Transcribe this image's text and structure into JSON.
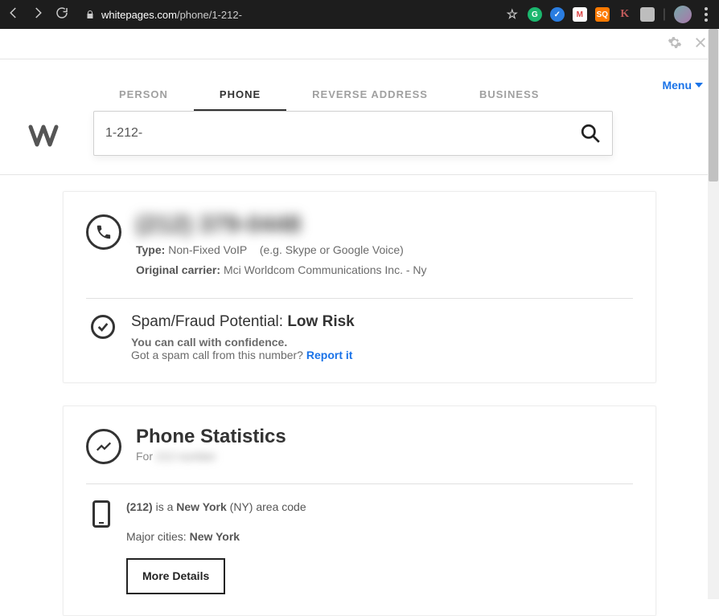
{
  "browser": {
    "url_host": "whitepages.com",
    "url_path": "/phone/1-212-",
    "extensions": {
      "star": "☆",
      "grammarly_bg": "#1bb76e",
      "blue_check_bg": "#2a7de1",
      "mail_letter": "M",
      "sq_text": "SQ",
      "sq_bg": "#ff7a00",
      "k_letter": "K",
      "k_color": "#c05a5a",
      "gray_bg": "#bdbdbd"
    }
  },
  "tabs": {
    "person": "PERSON",
    "phone": "PHONE",
    "reverse": "REVERSE ADDRESS",
    "business": "BUSINESS"
  },
  "menu_label": "Menu",
  "search": {
    "value": "1-212-"
  },
  "phone_result": {
    "number_blurred": "(212) 379-0448",
    "type_label": "Type:",
    "type_value": "Non-Fixed VoIP",
    "type_hint": "(e.g. Skype or Google Voice)",
    "carrier_label": "Original carrier:",
    "carrier_value": "Mci Worldcom Communications Inc. - Ny",
    "spam": {
      "prefix": "Spam/Fraud Potential:",
      "level": "Low Risk",
      "confidence": "You can call with confidence.",
      "got_spam": "Got a spam call from this number?",
      "report": "Report it"
    }
  },
  "stats": {
    "title": "Phone Statistics",
    "for_label": "For",
    "for_blurred": "212 number",
    "area_code": "(212)",
    "is_a": "is a",
    "state": "New York",
    "state_abbrev": "(NY)",
    "area_suffix": "area code",
    "major_label": "Major cities:",
    "major_city": "New York",
    "more": "More Details"
  }
}
